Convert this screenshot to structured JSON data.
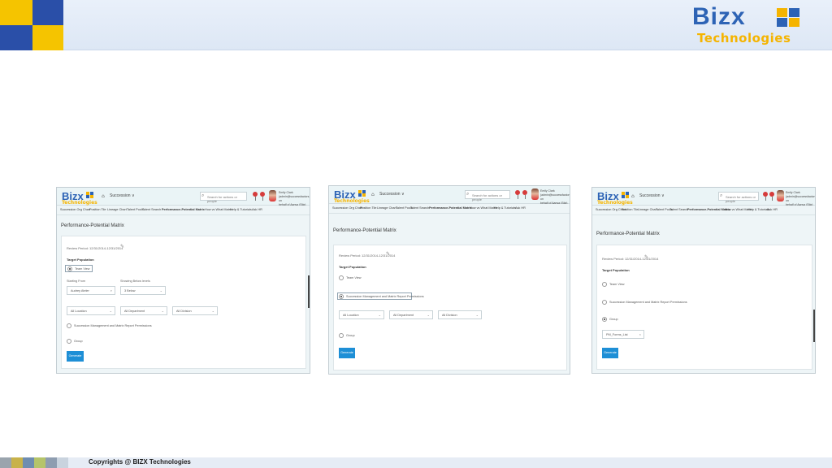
{
  "slide": {
    "brand_word": "Bizx",
    "brand_sub": "Technologies",
    "footer_text": "Copyrights @ BIZX Technologies"
  },
  "colors": {
    "brand_blue": "#2d63b5",
    "brand_yellow": "#f5b400",
    "primary_button": "#1e8fd6"
  },
  "app": {
    "logo_word": "Bizx",
    "logo_sub": "Technologies",
    "module": "Succession ∨",
    "search_placeholder": "Search for actions or people",
    "user_line1": "Emily Clark (admin@successfactors.com on",
    "user_line2": "behalf of Aanya (Stig) Jalotte)",
    "nav": [
      "Succession Org Chart",
      "Position Tile",
      "Lineage Chart",
      "Talent Pools",
      "Talent Search",
      "Performance-Potential Matrix",
      "How vs What Matrix",
      "Help & Tutorials",
      "Ask HR"
    ],
    "page_title": "Performance-Potential Matrix",
    "review_period": "Review Period: 12/31/2014-12/31/2014",
    "target_population": "Target Population",
    "team_view": "Team View",
    "starting_from_label": "Starting From",
    "starting_from_value": "Audrey Ateler",
    "showing_below_label": "Showing Below levels",
    "showing_below_value": "3 Below",
    "location": "All Location",
    "department": "All Department",
    "division": "All Division",
    "succession_perm": "Succession Management and Matrix Report Permissions",
    "group": "Group",
    "group_value": "PM_Forms_List",
    "generate": "Generate"
  }
}
